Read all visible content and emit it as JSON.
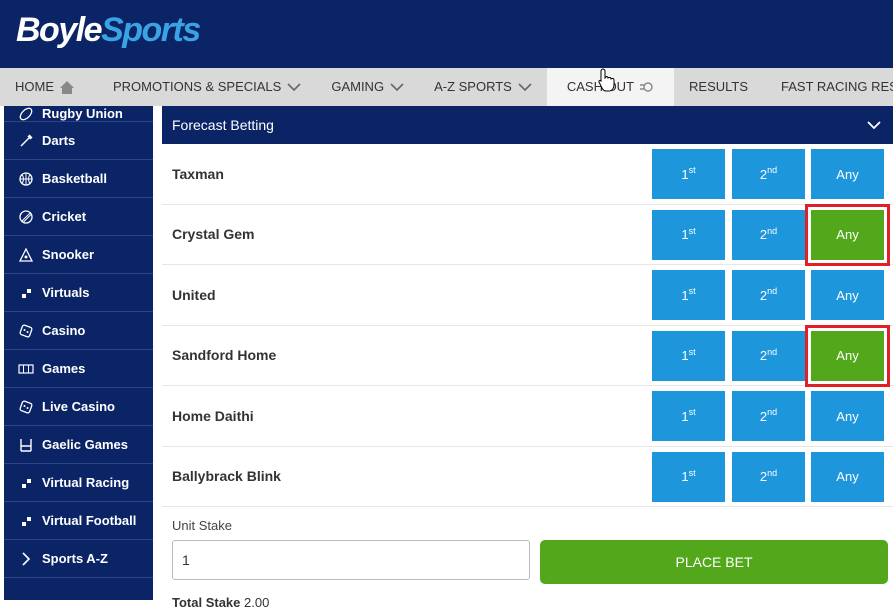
{
  "brand": {
    "part1": "Boyle",
    "part2": "Sports"
  },
  "nav": [
    {
      "label": "HOME",
      "icon": "home-icon"
    },
    {
      "label": "PROMOTIONS & SPECIALS",
      "icon": "chevron-down-icon"
    },
    {
      "label": "GAMING",
      "icon": "chevron-down-icon"
    },
    {
      "label": "A-Z SPORTS",
      "icon": "chevron-down-icon"
    },
    {
      "label": "CASH OUT",
      "icon": "cash-out-icon"
    },
    {
      "label": "RESULTS"
    },
    {
      "label": "FAST RACING RESULTS"
    }
  ],
  "sidebar": [
    {
      "label": "Rugby Union",
      "icon": "rugby-ball-icon"
    },
    {
      "label": "Darts",
      "icon": "dart-icon"
    },
    {
      "label": "Basketball",
      "icon": "basketball-icon"
    },
    {
      "label": "Cricket",
      "icon": "cricket-ball-icon"
    },
    {
      "label": "Snooker",
      "icon": "snooker-triangle-icon"
    },
    {
      "label": "Virtuals",
      "icon": "virtuals-icon"
    },
    {
      "label": "Casino",
      "icon": "dice-icon"
    },
    {
      "label": "Games",
      "icon": "slot-machine-icon"
    },
    {
      "label": "Live Casino",
      "icon": "dice-icon"
    },
    {
      "label": "Gaelic Games",
      "icon": "goalpost-icon"
    },
    {
      "label": "Virtual Racing",
      "icon": "virtuals-icon"
    },
    {
      "label": "Virtual Football",
      "icon": "virtuals-icon"
    },
    {
      "label": "Sports A-Z",
      "icon": "chevron-right-icon"
    }
  ],
  "forecast": {
    "title": "Forecast Betting",
    "buttons": {
      "first": "1",
      "first_sup": "st",
      "second": "2",
      "second_sup": "nd",
      "any": "Any"
    },
    "runners": [
      {
        "name": "Taxman",
        "selected": ""
      },
      {
        "name": "Crystal Gem",
        "selected": "any"
      },
      {
        "name": "United",
        "selected": ""
      },
      {
        "name": "Sandford Home",
        "selected": "any"
      },
      {
        "name": "Home Daithi",
        "selected": ""
      },
      {
        "name": "Ballybrack Blink",
        "selected": ""
      }
    ]
  },
  "betslip": {
    "unit_stake_label": "Unit Stake",
    "unit_stake_value": "1",
    "place_bet_label": "PLACE BET",
    "total_stake_label": "Total Stake",
    "total_stake_value": "2.00"
  },
  "colors": {
    "brand_navy": "#0a2466",
    "button_blue": "#1e96dc",
    "selected_green": "#52a81a",
    "highlight_red": "#e01f26"
  }
}
